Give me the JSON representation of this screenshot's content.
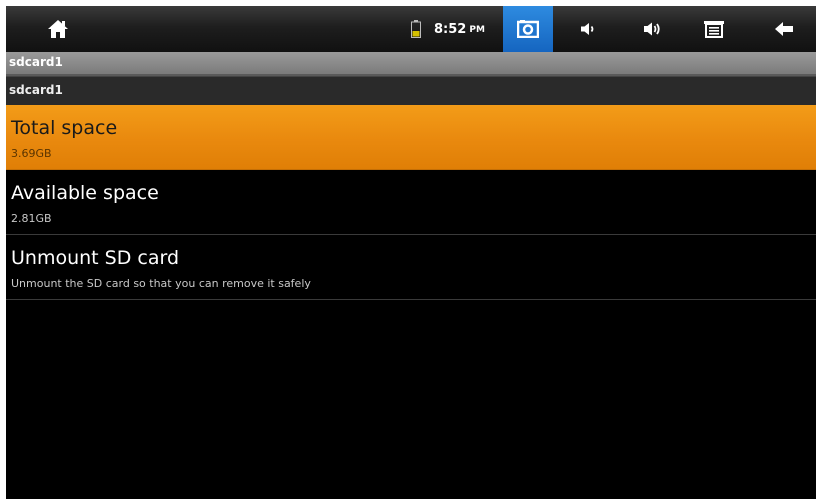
{
  "status_bar": {
    "icons": [
      "home-icon",
      "battery-icon",
      "screenshot-icon",
      "volume-down-icon",
      "volume-up-icon",
      "menu-icon",
      "back-arrow-icon"
    ],
    "time": "8:52",
    "ampm": "PM",
    "colors": {
      "battery": "#d4c000",
      "screenshot_bg": "#1e78d2"
    }
  },
  "header": {
    "title": "sdcard1",
    "subtitle": "sdcard1"
  },
  "list": {
    "items": [
      {
        "title": "Total space",
        "summary": "3.69GB",
        "selected": true
      },
      {
        "title": "Available space",
        "summary": "2.81GB",
        "selected": false
      },
      {
        "title": "Unmount SD card",
        "summary": "Unmount the SD card so that you can remove it safely",
        "selected": false
      }
    ]
  },
  "colors": {
    "selection": "#ee8f10",
    "background": "#000000"
  }
}
